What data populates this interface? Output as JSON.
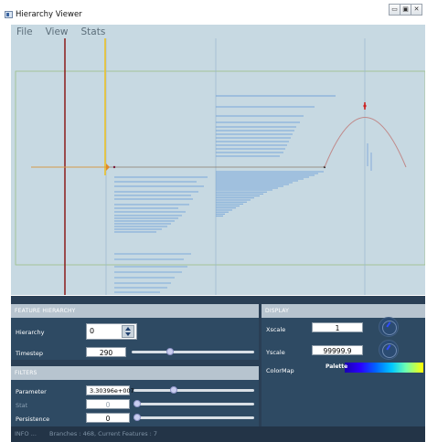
{
  "window": {
    "title": "Hierarchy Viewer"
  },
  "menu": {
    "items": [
      "File",
      "View",
      "Stats"
    ]
  },
  "feature_hierarchy": {
    "header": "FEATURE HIERARCHY",
    "hierarchy_label": "Hierarchy",
    "hierarchy_value": "0",
    "timestep_label": "Timestep",
    "timestep_value": "290",
    "timestep_slider_fraction": 0.3
  },
  "filters": {
    "header": "FILTERS",
    "parameter_label": "Parameter",
    "parameter_value": "3.30396e+007",
    "parameter_slider_fraction": 0.32,
    "stat_label": "Stat",
    "stat_value": "0",
    "stat_slider_fraction": 0.0,
    "persistence_label": "Persistence",
    "persistence_value": "0",
    "persistence_slider_fraction": 0.0
  },
  "display": {
    "header": "DISPLAY",
    "xscale_label": "Xscale",
    "xscale_value": "1",
    "yscale_label": "Yscale",
    "yscale_value": "99999.9",
    "colormap_label": "ColorMap",
    "palette_label": "Palette"
  },
  "status": {
    "info": "INFO ...",
    "branches": "Branches : 468, Current Features : 7"
  },
  "colors": {
    "canvas_bg": "#c7d9e2",
    "panel_bg": "#2e4a63",
    "panel_header": "#b7c4cf",
    "red_line": "#8b1a1a",
    "yellow_line": "#e8c33a",
    "branch_blue": "#6c9fd8"
  },
  "icons": {
    "minimize": "minimize-icon",
    "maximize": "maximize-icon",
    "close": "close-icon"
  }
}
